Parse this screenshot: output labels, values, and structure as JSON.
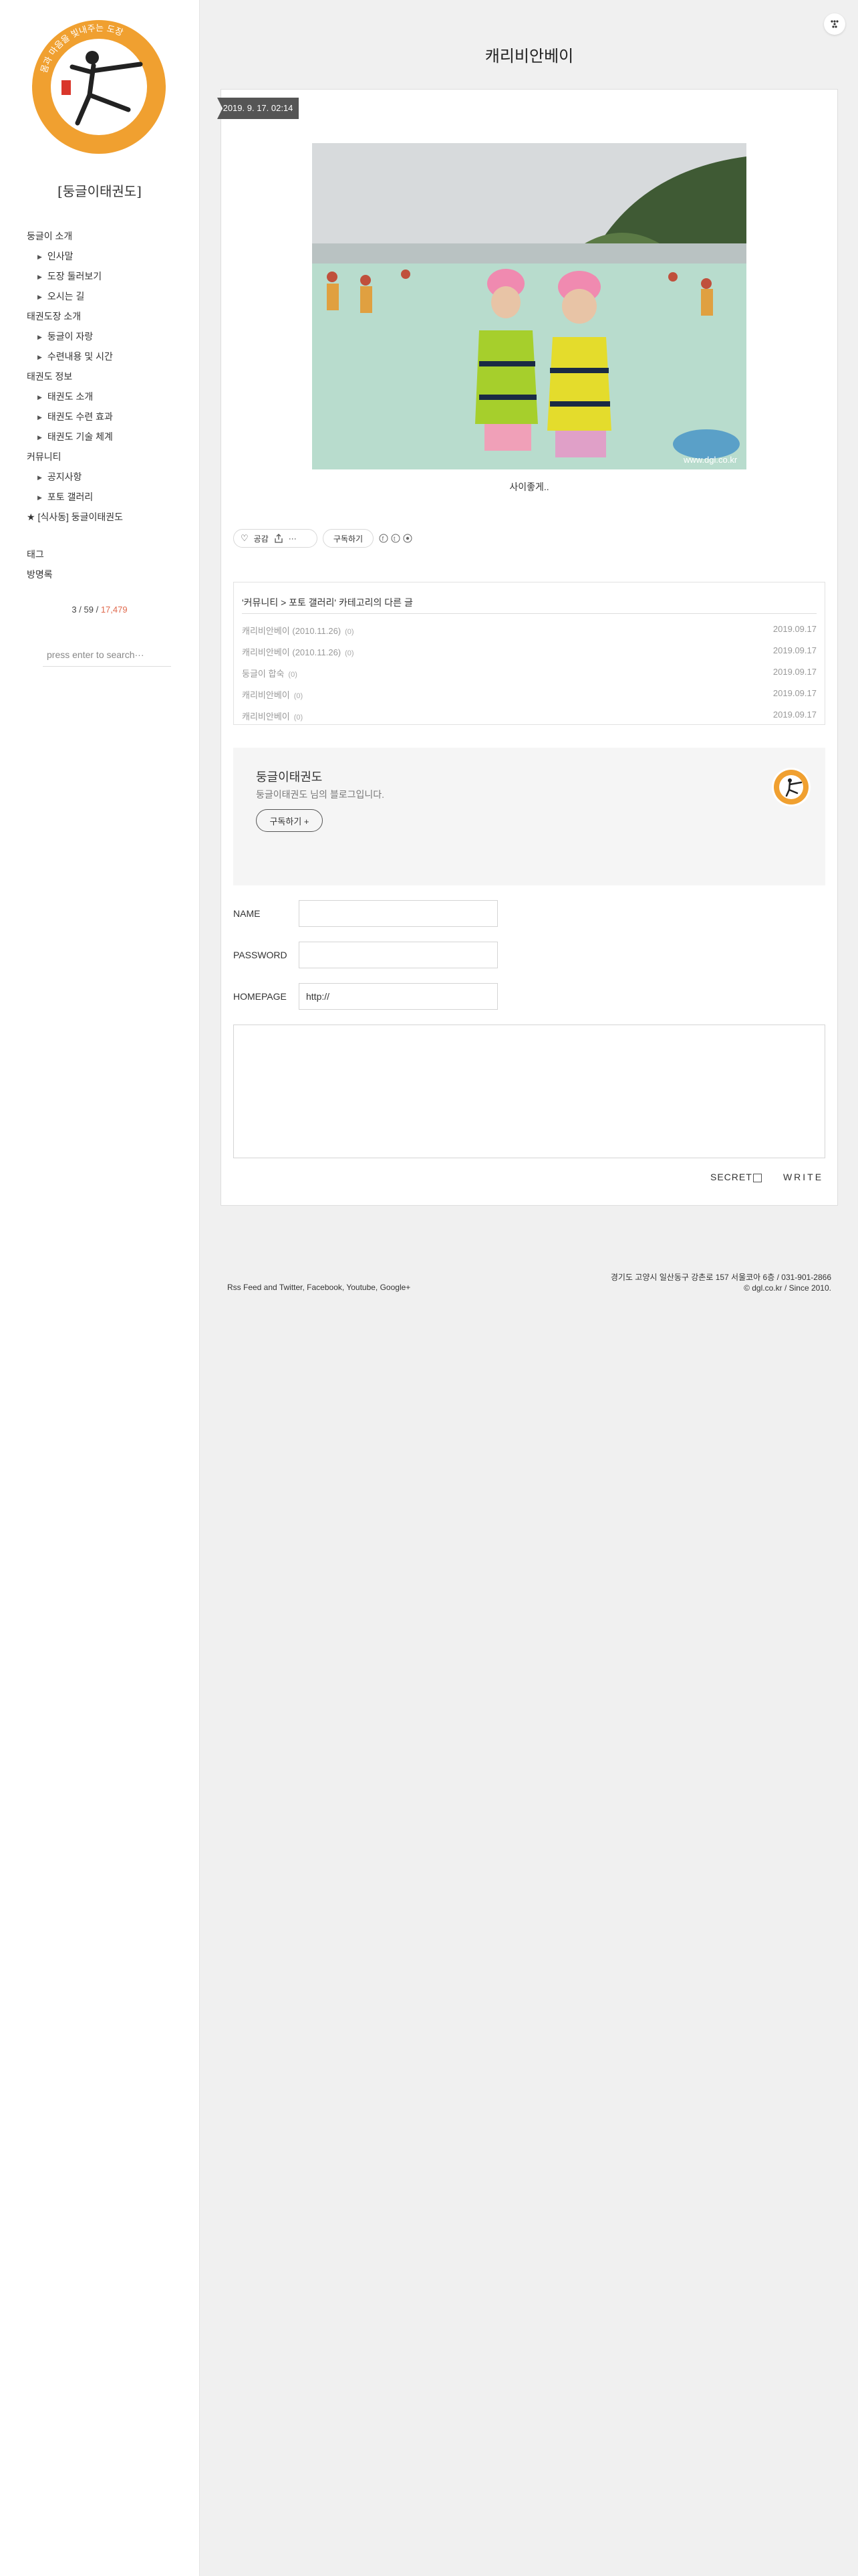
{
  "sidebar": {
    "logo_text": "몸과 마음을 빛내주는 도장",
    "blog_title": "[둥글이태권도]",
    "nav": [
      {
        "label": "둥글이 소개",
        "sub": false
      },
      {
        "label": "인사말",
        "sub": true
      },
      {
        "label": "도장 둘러보기",
        "sub": true
      },
      {
        "label": "오시는 길",
        "sub": true
      },
      {
        "label": "태권도장 소개",
        "sub": false
      },
      {
        "label": "둥글이 자랑",
        "sub": true
      },
      {
        "label": "수련내용 및 시간",
        "sub": true
      },
      {
        "label": "태권도 정보",
        "sub": false
      },
      {
        "label": "태권도 소개",
        "sub": true
      },
      {
        "label": "태권도 수련 효과",
        "sub": true
      },
      {
        "label": "태권도 기술 체계",
        "sub": true
      },
      {
        "label": "커뮤니티",
        "sub": false
      },
      {
        "label": "공지사항",
        "sub": true
      },
      {
        "label": "포토 갤러리",
        "sub": true
      },
      {
        "label": "★ [식사동] 둥글이태권도",
        "sub": false
      }
    ],
    "extra_links": [
      "태그",
      "방명록"
    ],
    "visitors": {
      "today": "3",
      "yesterday": "59",
      "total": "17,479"
    },
    "search_placeholder": "press enter to search···"
  },
  "post": {
    "title": "캐리비안베이",
    "date": "2019. 9. 17. 02:14",
    "image_watermark": "www.dgl.co.kr",
    "caption": "사이좋게..",
    "like_label": "공감",
    "more_label": "···",
    "subscribe_small_label": "구독하기"
  },
  "related": {
    "heading": "'커뮤니티 > 포토 갤러리' 카테고리의 다른 글",
    "items": [
      {
        "title": "캐리비안베이 (2010.11.26)",
        "count": "(0)",
        "date": "2019.09.17"
      },
      {
        "title": "캐리비안베이 (2010.11.26)",
        "count": "(0)",
        "date": "2019.09.17"
      },
      {
        "title": "둥글이 합숙",
        "count": "(0)",
        "date": "2019.09.17"
      },
      {
        "title": "캐리비안베이",
        "count": "(0)",
        "date": "2019.09.17"
      },
      {
        "title": "캐리비안베이",
        "count": "(0)",
        "date": "2019.09.17"
      }
    ]
  },
  "subscribe": {
    "name": "둥글이태권도",
    "desc": "둥글이태권도 님의 블로그입니다.",
    "button": "구독하기 +"
  },
  "comment_form": {
    "name_label": "NAME",
    "password_label": "PASSWORD",
    "homepage_label": "HOMEPAGE",
    "homepage_value": "http://",
    "secret_label": "SECRET",
    "write_label": "WRITE"
  },
  "footer": {
    "left": "Rss Feed and Twitter, Facebook, Youtube, Google+",
    "address": "경기도 고양시 일산동구 강촌로 157 서울코아 6층 / 031-901-2866",
    "copyright": "© dgl.co.kr / Since 2010."
  },
  "colors": {
    "accent_orange": "#f0a030",
    "visitor_total": "#e06a4e",
    "date_tag": "#555555"
  }
}
